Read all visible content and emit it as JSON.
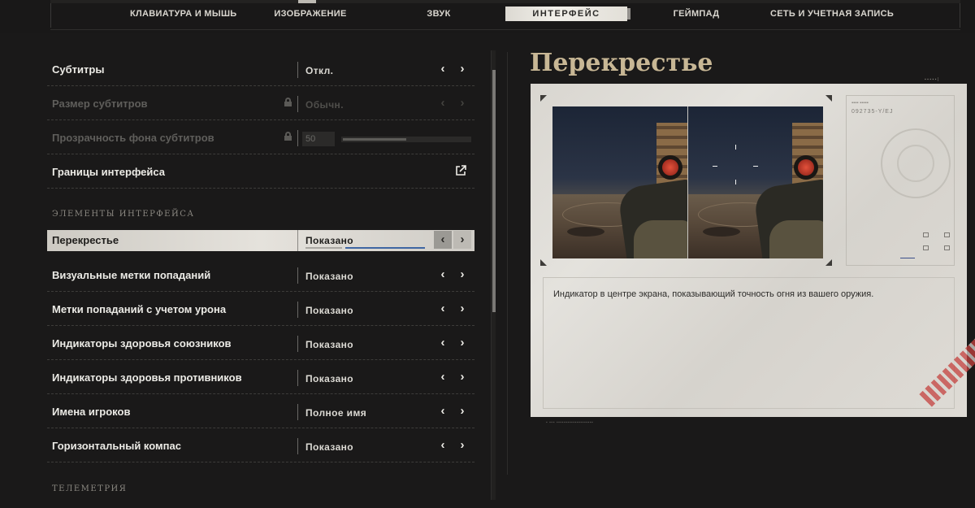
{
  "nav": {
    "tabs": [
      {
        "label": "КЛАВИАТУРА И МЫШЬ"
      },
      {
        "label": "ИЗОБРАЖЕНИЕ"
      },
      {
        "label": "ЗВУК"
      },
      {
        "label": "ИНТЕРФЕЙС"
      },
      {
        "label": "ГЕЙМПАД"
      },
      {
        "label": "СЕТЬ И УЧЕТНАЯ ЗАПИСЬ"
      }
    ],
    "active_tab": "ИНТЕРФЕЙС"
  },
  "settings": {
    "rows": [
      {
        "label": "Субтитры",
        "value": "Откл.",
        "disabled": false
      },
      {
        "label": "Размер субтитров",
        "value": "Обычн.",
        "disabled": true
      },
      {
        "label": "Прозрачность фона субтитров",
        "value": "50",
        "disabled": true,
        "slider_fraction": 0.5
      },
      {
        "label": "Границы интерфейса",
        "value": "",
        "disabled": false
      }
    ],
    "section_hud": "ЭЛЕМЕНТЫ ИНТЕРФЕЙСА",
    "hud_rows": [
      {
        "label": "Перекрестье",
        "value": "Показано",
        "selected": true
      },
      {
        "label": "Визуальные метки попаданий",
        "value": "Показано"
      },
      {
        "label": "Метки попаданий с учетом урона",
        "value": "Показано"
      },
      {
        "label": "Индикаторы здоровья союзников",
        "value": "Показано"
      },
      {
        "label": "Индикаторы здоровья противников",
        "value": "Показано"
      },
      {
        "label": "Имена игроков",
        "value": "Полное имя"
      },
      {
        "label": "Горизонтальный компас",
        "value": "Показано"
      }
    ],
    "section_telemetry": "ТЕЛЕМЕТРИЯ"
  },
  "scrollbar": {
    "position_fraction": 0.05,
    "visible_fraction": 0.54
  },
  "detail": {
    "title": "Перекрестье",
    "description": "Индикатор в центре экрана, показывающий точность огня из вашего оружия.",
    "card_number": "092735-Y/ЕЈ"
  },
  "icons": {
    "prev": "chevron-left-icon",
    "next": "chevron-right-icon",
    "lock": "lock-icon",
    "external": "external-link-icon"
  },
  "colors": {
    "accent_title": "#c8b795",
    "selected_row": "#e5e2dc",
    "selected_underline": "#3f66a3",
    "paper": "#e0ddd7",
    "stamp_stripe": "#c4413e"
  }
}
